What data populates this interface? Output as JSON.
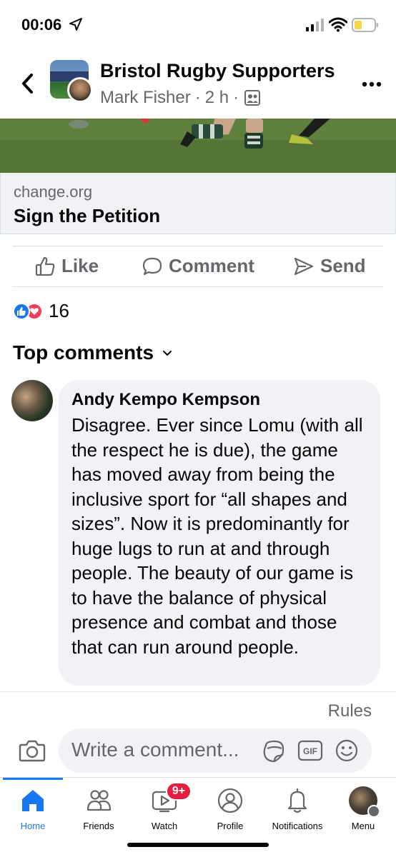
{
  "status_bar": {
    "time": "00:06"
  },
  "header": {
    "group_name": "Bristol Rugby Supporters",
    "author": "Mark Fisher",
    "separator": "·",
    "time_ago": "2 h",
    "separator2": "·"
  },
  "link_preview": {
    "domain": "change.org",
    "title": "Sign the Petition"
  },
  "actions": {
    "like": "Like",
    "comment": "Comment",
    "send": "Send"
  },
  "reactions": {
    "count": "16"
  },
  "comments_section": {
    "heading": "Top comments"
  },
  "comment": {
    "author": "Andy Kempo Kempson",
    "text": "Disagree. Ever since Lomu (with all the respect he is due), the game has moved away from being the inclusive sport for “all shapes and sizes”. Now it is predominantly for huge lugs to run at and through people. The beauty of our game is to have the balance of physical presence and combat and those that can run around people."
  },
  "rules_link": "Rules",
  "composer": {
    "placeholder": "Write a comment..."
  },
  "bottom_nav": {
    "home": "Home",
    "friends": "Friends",
    "watch": "Watch",
    "watch_badge": "9+",
    "profile": "Profile",
    "notifications": "Notifications",
    "menu": "Menu"
  },
  "colors": {
    "accent": "#1877f2",
    "like": "#1877f2",
    "love": "#f33e58",
    "badge": "#e41e3f",
    "secondary_text": "#65676b",
    "bubble": "#f0f2f5"
  }
}
